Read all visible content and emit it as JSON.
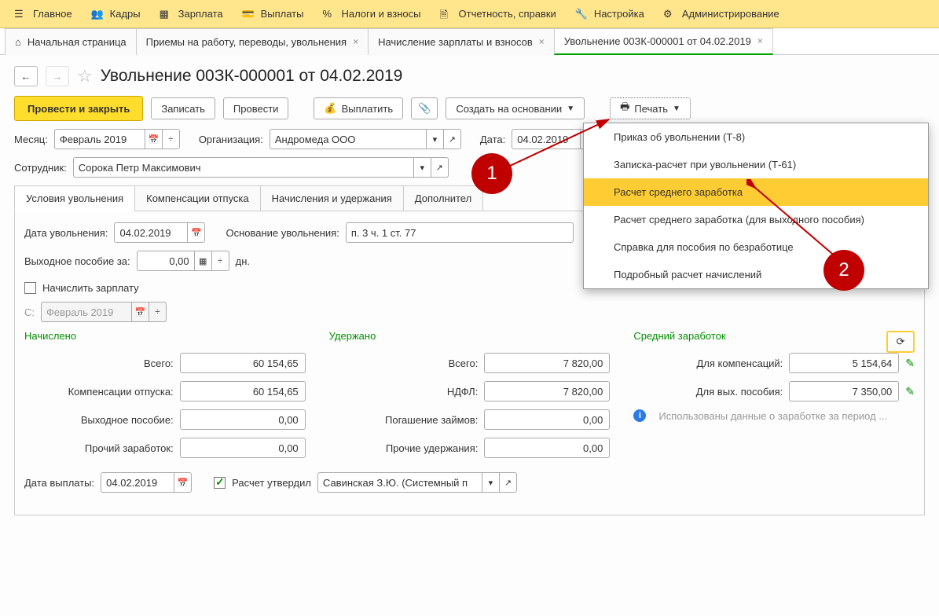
{
  "topmenu": {
    "main": "Главное",
    "staff": "Кадры",
    "salary": "Зарплата",
    "payments": "Выплаты",
    "taxes": "Налоги и взносы",
    "reports": "Отчетность, справки",
    "settings": "Настройка",
    "admin": "Администрирование"
  },
  "tabs": {
    "home": "Начальная страница",
    "t2": "Приемы на работу, переводы, увольнения",
    "t3": "Начисление зарплаты и взносов",
    "t4": "Увольнение 00ЗК-000001 от 04.02.2019"
  },
  "page": {
    "title": "Увольнение 00ЗК-000001 от 04.02.2019"
  },
  "toolbar": {
    "post_close": "Провести и закрыть",
    "write": "Записать",
    "post": "Провести",
    "pay": "Выплатить",
    "create_based": "Создать на основании",
    "print": "Печать"
  },
  "fields": {
    "month_label": "Месяц:",
    "month_value": "Февраль 2019",
    "org_label": "Организация:",
    "org_value": "Андромеда ООО",
    "date_label": "Дата:",
    "date_value": "04.02.2019",
    "employee_label": "Сотрудник:",
    "employee_value": "Сорока Петр Максимович"
  },
  "section_tabs": {
    "conditions": "Условия увольнения",
    "compensation": "Компенсации отпуска",
    "charges": "Начисления и удержания",
    "additional": "Дополнител"
  },
  "conditions": {
    "dismissal_date_label": "Дата увольнения:",
    "dismissal_date_value": "04.02.2019",
    "basis_label": "Основание увольнения:",
    "basis_value": "п. 3 ч. 1 ст. 77",
    "severance_label": "Выходное пособие за:",
    "severance_value": "0,00",
    "days": "дн.",
    "accrue_salary": "Начислить зарплату",
    "from_label": "С:",
    "from_value": "Февраль 2019"
  },
  "columns": {
    "accrued": "Начислено",
    "withheld": "Удержано",
    "average": "Средний заработок"
  },
  "accrued": {
    "total_label": "Всего:",
    "total_value": "60 154,65",
    "comp_label": "Компенсации отпуска:",
    "comp_value": "60 154,65",
    "sev_label": "Выходное пособие:",
    "sev_value": "0,00",
    "other_label": "Прочий заработок:",
    "other_value": "0,00"
  },
  "withheld": {
    "total_label": "Всего:",
    "total_value": "7 820,00",
    "ndfl_label": "НДФЛ:",
    "ndfl_value": "7 820,00",
    "loan_label": "Погашение займов:",
    "loan_value": "0,00",
    "other_label": "Прочие удержания:",
    "other_value": "0,00"
  },
  "average": {
    "comp_label": "Для компенсаций:",
    "comp_value": "5 154,64",
    "sev_label": "Для вых. пособия:",
    "sev_value": "7 350,00",
    "info_text": "Использованы данные о заработке за период ..."
  },
  "footer": {
    "paydate_label": "Дата выплаты:",
    "paydate_value": "04.02.2019",
    "approved_label": "Расчет утвердил",
    "approver_value": "Савинская З.Ю. (Системный п"
  },
  "print_menu": {
    "i1": "Приказ об увольнении (Т-8)",
    "i2": "Записка-расчет при увольнении (Т-61)",
    "i3": "Расчет среднего заработка",
    "i4": "Расчет среднего заработка (для выходного пособия)",
    "i5": "Справка для пособия по безработице",
    "i6": "Подробный расчет начислений"
  },
  "badges": {
    "b1": "1",
    "b2": "2"
  }
}
